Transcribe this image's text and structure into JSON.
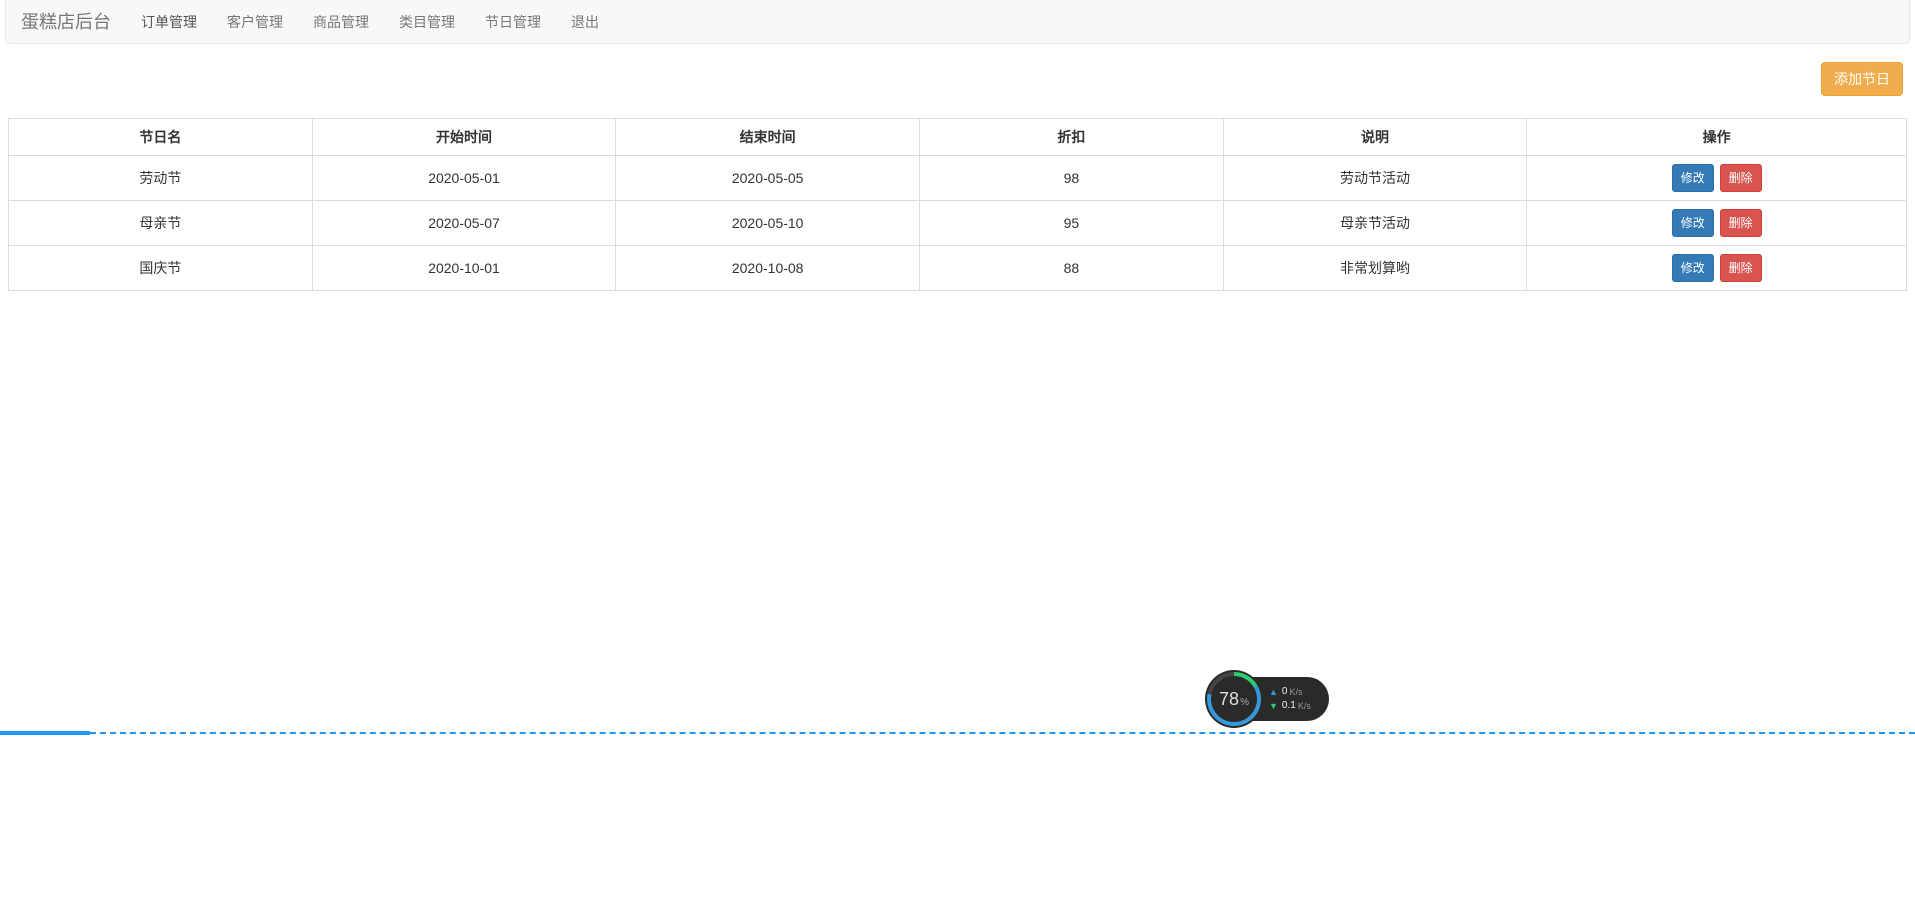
{
  "navbar": {
    "brand": "蛋糕店后台",
    "items": [
      {
        "label": "订单管理",
        "active": true
      },
      {
        "label": "客户管理",
        "active": false
      },
      {
        "label": "商品管理",
        "active": false
      },
      {
        "label": "类目管理",
        "active": false
      },
      {
        "label": "节日管理",
        "active": false
      },
      {
        "label": "退出",
        "active": false
      }
    ]
  },
  "buttons": {
    "add_festival": "添加节日",
    "edit": "修改",
    "delete": "删除"
  },
  "table": {
    "headers": {
      "name": "节日名",
      "start": "开始时间",
      "end": "结束时间",
      "discount": "折扣",
      "desc": "说明",
      "op": "操作"
    },
    "rows": [
      {
        "name": "劳动节",
        "start": "2020-05-01",
        "end": "2020-05-05",
        "discount": "98",
        "desc": "劳动节活动"
      },
      {
        "name": "母亲节",
        "start": "2020-05-07",
        "end": "2020-05-10",
        "discount": "95",
        "desc": "母亲节活动"
      },
      {
        "name": "国庆节",
        "start": "2020-10-01",
        "end": "2020-10-08",
        "discount": "88",
        "desc": "非常划算哟"
      }
    ]
  },
  "sys_widget": {
    "percent": "78",
    "percent_sym": "%",
    "up_value": "0",
    "up_unit": "K/s",
    "down_value": "0.1",
    "down_unit": "K/s"
  }
}
